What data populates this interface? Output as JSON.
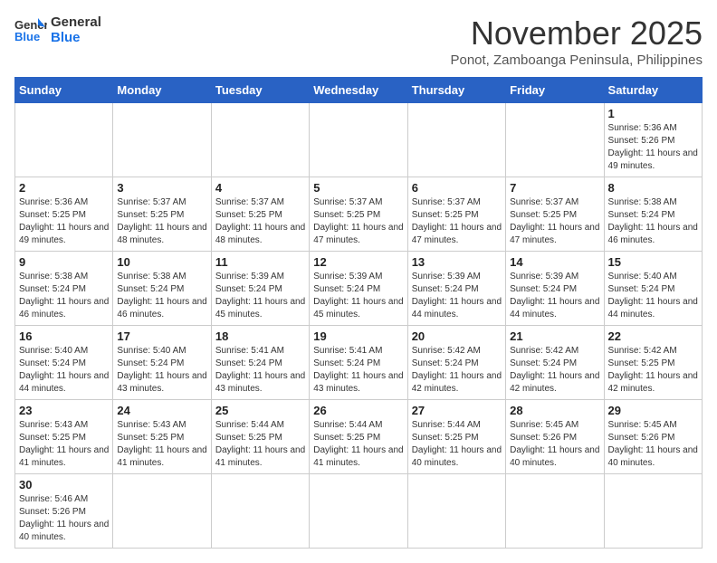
{
  "header": {
    "logo_line1": "General",
    "logo_line2": "Blue",
    "month": "November 2025",
    "location": "Ponot, Zamboanga Peninsula, Philippines"
  },
  "days_of_week": [
    "Sunday",
    "Monday",
    "Tuesday",
    "Wednesday",
    "Thursday",
    "Friday",
    "Saturday"
  ],
  "weeks": [
    [
      {
        "day": "",
        "info": ""
      },
      {
        "day": "",
        "info": ""
      },
      {
        "day": "",
        "info": ""
      },
      {
        "day": "",
        "info": ""
      },
      {
        "day": "",
        "info": ""
      },
      {
        "day": "",
        "info": ""
      },
      {
        "day": "1",
        "info": "Sunrise: 5:36 AM\nSunset: 5:26 PM\nDaylight: 11 hours and 49 minutes."
      }
    ],
    [
      {
        "day": "2",
        "info": "Sunrise: 5:36 AM\nSunset: 5:25 PM\nDaylight: 11 hours and 49 minutes."
      },
      {
        "day": "3",
        "info": "Sunrise: 5:37 AM\nSunset: 5:25 PM\nDaylight: 11 hours and 48 minutes."
      },
      {
        "day": "4",
        "info": "Sunrise: 5:37 AM\nSunset: 5:25 PM\nDaylight: 11 hours and 48 minutes."
      },
      {
        "day": "5",
        "info": "Sunrise: 5:37 AM\nSunset: 5:25 PM\nDaylight: 11 hours and 47 minutes."
      },
      {
        "day": "6",
        "info": "Sunrise: 5:37 AM\nSunset: 5:25 PM\nDaylight: 11 hours and 47 minutes."
      },
      {
        "day": "7",
        "info": "Sunrise: 5:37 AM\nSunset: 5:25 PM\nDaylight: 11 hours and 47 minutes."
      },
      {
        "day": "8",
        "info": "Sunrise: 5:38 AM\nSunset: 5:24 PM\nDaylight: 11 hours and 46 minutes."
      }
    ],
    [
      {
        "day": "9",
        "info": "Sunrise: 5:38 AM\nSunset: 5:24 PM\nDaylight: 11 hours and 46 minutes."
      },
      {
        "day": "10",
        "info": "Sunrise: 5:38 AM\nSunset: 5:24 PM\nDaylight: 11 hours and 46 minutes."
      },
      {
        "day": "11",
        "info": "Sunrise: 5:39 AM\nSunset: 5:24 PM\nDaylight: 11 hours and 45 minutes."
      },
      {
        "day": "12",
        "info": "Sunrise: 5:39 AM\nSunset: 5:24 PM\nDaylight: 11 hours and 45 minutes."
      },
      {
        "day": "13",
        "info": "Sunrise: 5:39 AM\nSunset: 5:24 PM\nDaylight: 11 hours and 44 minutes."
      },
      {
        "day": "14",
        "info": "Sunrise: 5:39 AM\nSunset: 5:24 PM\nDaylight: 11 hours and 44 minutes."
      },
      {
        "day": "15",
        "info": "Sunrise: 5:40 AM\nSunset: 5:24 PM\nDaylight: 11 hours and 44 minutes."
      }
    ],
    [
      {
        "day": "16",
        "info": "Sunrise: 5:40 AM\nSunset: 5:24 PM\nDaylight: 11 hours and 44 minutes."
      },
      {
        "day": "17",
        "info": "Sunrise: 5:40 AM\nSunset: 5:24 PM\nDaylight: 11 hours and 43 minutes."
      },
      {
        "day": "18",
        "info": "Sunrise: 5:41 AM\nSunset: 5:24 PM\nDaylight: 11 hours and 43 minutes."
      },
      {
        "day": "19",
        "info": "Sunrise: 5:41 AM\nSunset: 5:24 PM\nDaylight: 11 hours and 43 minutes."
      },
      {
        "day": "20",
        "info": "Sunrise: 5:42 AM\nSunset: 5:24 PM\nDaylight: 11 hours and 42 minutes."
      },
      {
        "day": "21",
        "info": "Sunrise: 5:42 AM\nSunset: 5:24 PM\nDaylight: 11 hours and 42 minutes."
      },
      {
        "day": "22",
        "info": "Sunrise: 5:42 AM\nSunset: 5:25 PM\nDaylight: 11 hours and 42 minutes."
      }
    ],
    [
      {
        "day": "23",
        "info": "Sunrise: 5:43 AM\nSunset: 5:25 PM\nDaylight: 11 hours and 41 minutes."
      },
      {
        "day": "24",
        "info": "Sunrise: 5:43 AM\nSunset: 5:25 PM\nDaylight: 11 hours and 41 minutes."
      },
      {
        "day": "25",
        "info": "Sunrise: 5:44 AM\nSunset: 5:25 PM\nDaylight: 11 hours and 41 minutes."
      },
      {
        "day": "26",
        "info": "Sunrise: 5:44 AM\nSunset: 5:25 PM\nDaylight: 11 hours and 41 minutes."
      },
      {
        "day": "27",
        "info": "Sunrise: 5:44 AM\nSunset: 5:25 PM\nDaylight: 11 hours and 40 minutes."
      },
      {
        "day": "28",
        "info": "Sunrise: 5:45 AM\nSunset: 5:26 PM\nDaylight: 11 hours and 40 minutes."
      },
      {
        "day": "29",
        "info": "Sunrise: 5:45 AM\nSunset: 5:26 PM\nDaylight: 11 hours and 40 minutes."
      }
    ],
    [
      {
        "day": "30",
        "info": "Sunrise: 5:46 AM\nSunset: 5:26 PM\nDaylight: 11 hours and 40 minutes."
      },
      {
        "day": "",
        "info": ""
      },
      {
        "day": "",
        "info": ""
      },
      {
        "day": "",
        "info": ""
      },
      {
        "day": "",
        "info": ""
      },
      {
        "day": "",
        "info": ""
      },
      {
        "day": "",
        "info": ""
      }
    ]
  ]
}
